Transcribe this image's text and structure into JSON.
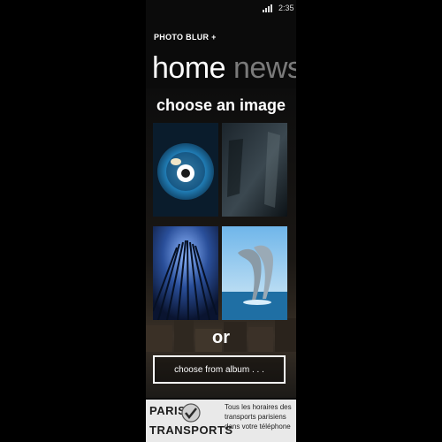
{
  "status": {
    "time": "2:35"
  },
  "app": {
    "title": "PHOTO BLUR +"
  },
  "pivot": {
    "active": "home",
    "inactive": "news"
  },
  "main": {
    "heading": "choose an image",
    "tiles": [
      {
        "icon": "pokeball-orb-image"
      },
      {
        "icon": "dark-glass-image"
      },
      {
        "icon": "blue-forest-image"
      },
      {
        "icon": "dolphins-image"
      }
    ],
    "or_label": "or",
    "album_button": "choose from album . . ."
  },
  "ad": {
    "brand_line1": "PARIS",
    "brand_line2": "TRANSPORTS",
    "tagline": "Tous les horaires des transports parisiens dans votre téléphone"
  },
  "colors": {
    "background": "#000000",
    "accent": "#ffffff",
    "pivot_inactive": "#7a7a7a",
    "ad_background": "#e9e9e9"
  }
}
